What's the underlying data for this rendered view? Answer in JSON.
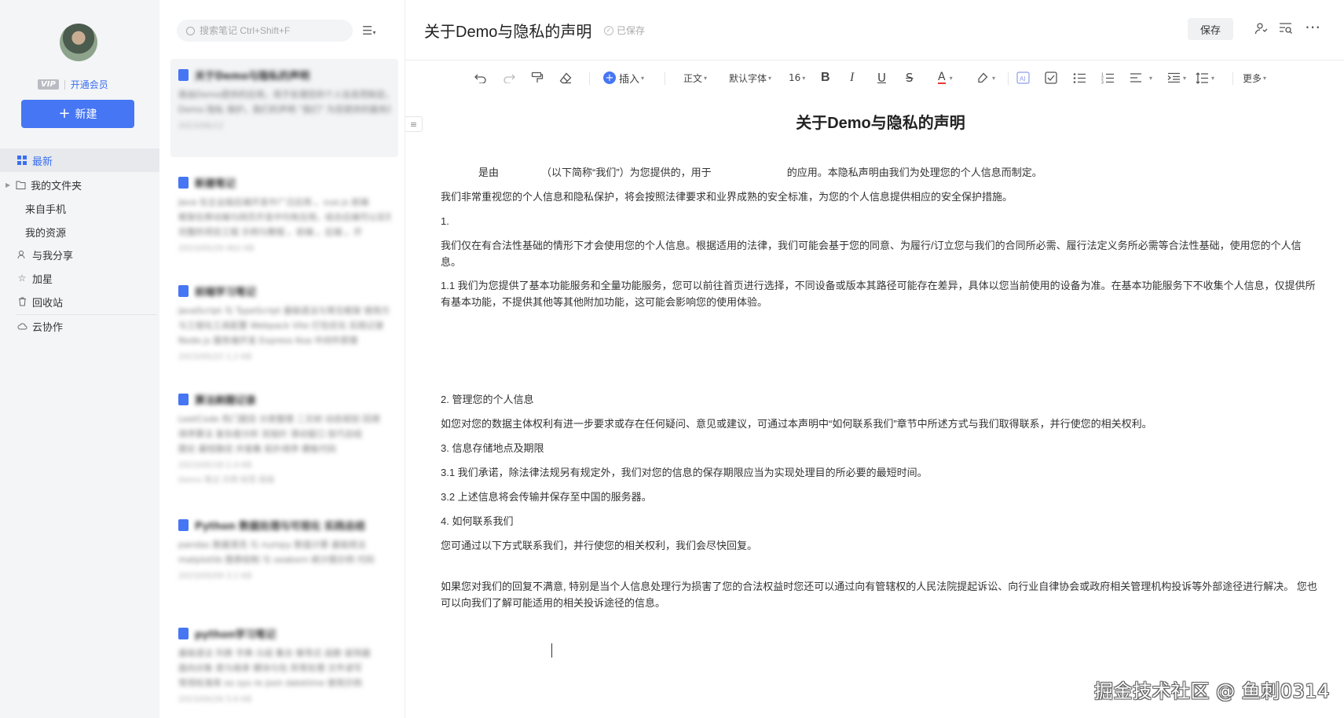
{
  "sidebar": {
    "vip_badge": "VIP",
    "vip_link": "开通会员",
    "new_button": "新建",
    "nav": [
      {
        "label": "最新",
        "icon": "grid-icon"
      },
      {
        "label": "我的文件夹",
        "icon": "folder-icon"
      },
      {
        "label": "来自手机",
        "icon": ""
      },
      {
        "label": "我的资源",
        "icon": ""
      },
      {
        "label": "与我分享",
        "icon": "user-share-icon"
      },
      {
        "label": "加星",
        "icon": "star-icon"
      },
      {
        "label": "回收站",
        "icon": "trash-icon"
      },
      {
        "label": "云协作",
        "icon": "cloud-icon"
      }
    ]
  },
  "notelist": {
    "search_placeholder": "搜索笔记 Ctrl+Shift+F",
    "notes": [
      {
        "title": "关于Demo与隐私的声明",
        "lines": [
          "是由Demo提供的应用，用于处理您的个人信息而制定。我们非常重视",
          "Demo 隐私 保护。我们的声明 \"我们\" 为您提供的服务而"
        ],
        "meta": "2023/06/12"
      },
      {
        "title": "新建笔记",
        "lines": [
          "Java 在企业级后端开发中广泛应用 。vue.js 前端",
          "框架在移动端与网页开发中均有应用，结合后端可以实现",
          "完整的项目工程 示例与教程 。前端 。后端 。开"
        ],
        "meta": "2023/05/29   402 KB"
      },
      {
        "title": "前端学习笔记",
        "lines": [
          "JavaScript 与 TypeScript 基础语法与常见框架 使用方式",
          "与工程化工具配置 Webpack Vite 打包优化 实践记录",
          "Node.js 服务端开发 Express Koa 中间件原理"
        ],
        "meta": "2023/05/22   1.2 KB"
      },
      {
        "title": "算法刷题记录",
        "lines": [
          "LeetCode 热门题目 分类整理 二叉树 动态规划 回溯",
          "排序算法 复杂度分析 双指针 滑动窗口 技巧总结",
          "图论 最短路径 并查集 拓扑排序 模板代码"
        ],
        "meta": "2023/05/18   2.4 KB",
        "tag": "Demo 笔记 示例 标签 链接"
      },
      {
        "title": "Python 数据处理与可视化 实践总结",
        "lines": [
          "pandas 数据清洗 与 numpy 数值计算 基础用法",
          "matplotlib 图表绘制 与 seaborn 统计图示例 代码"
        ],
        "meta": "2023/05/09   3.1 KB"
      },
      {
        "title": "python学习笔记",
        "lines": [
          "基础语法 列表 字典 元组 集合 推导式 函数 装饰器",
          "面向对象 类与继承 模块与包 异常处理 文件读写",
          "常用标准库 os sys re json datetime 使用示例"
        ],
        "meta": "2023/04/26   5.6 KB"
      }
    ]
  },
  "editor": {
    "title": "关于Demo与隐私的声明",
    "saved_text": "已保存",
    "save_button": "保存",
    "toolbar": {
      "insert": "插入",
      "paragraph": "正文",
      "font": "默认字体",
      "size": "16",
      "more": "更多"
    },
    "doc": {
      "heading": "关于Demo与隐私的声明",
      "para_intro_a": "是由",
      "para_intro_b": "（以下简称“我们”）为您提供的，用于",
      "para_intro_c": "的应用。本隐私声明由我们为处理您的个人信息而制定。",
      "p1": "我们非常重视您的个人信息和隐私保护，将会按照法律要求和业界成熟的安全标准，为您的个人信息提供相应的安全保护措施。",
      "p2": "1.",
      "p3": "我们仅在有合法性基础的情形下才会使用您的个人信息。根据适用的法律，我们可能会基于您的同意、为履行/订立您与我们的合同所必需、履行法定义务所必需等合法性基础，使用您的个人信息。",
      "p4": "1.1 我们为您提供了基本功能服务和全量功能服务，您可以前往首页进行选择，不同设备或版本其路径可能存在差异，具体以您当前使用的设备为准。在基本功能服务下不收集个人信息，仅提供所有基本功能，不提供其他等其他附加功能，这可能会影响您的使用体验。",
      "p5": "2. 管理您的个人信息",
      "p6": "如您对您的数据主体权利有进一步要求或存在任何疑问、意见或建议，可通过本声明中“如何联系我们”章节中所述方式与我们取得联系，并行使您的相关权利。",
      "p7": "3. 信息存储地点及期限",
      "p8": "3.1 我们承诺，除法律法规另有规定外，我们对您的信息的保存期限应当为实现处理目的所必要的最短时间。",
      "p9": "3.2 上述信息将会传输并保存至中国的服务器。",
      "p10": "4. 如何联系我们",
      "p11": "您可通过以下方式联系我们，并行使您的相关权利，我们会尽快回复。",
      "p12": "如果您对我们的回复不满意, 特别是当个人信息处理行为损害了您的合法权益时您还可以通过向有管辖权的人民法院提起诉讼、向行业自律协会或政府相关管理机构投诉等外部途径进行解决。 您也可以向我们了解可能适用的相关投诉途径的信息。"
    }
  },
  "watermark": "掘金技术社区 @ 鱼刺0314",
  "colors": {
    "accent": "#4676f3",
    "sidebar_bg": "#f4f5f7",
    "active_item_bg": "#e7e9ed",
    "link": "#3a6ff0"
  }
}
